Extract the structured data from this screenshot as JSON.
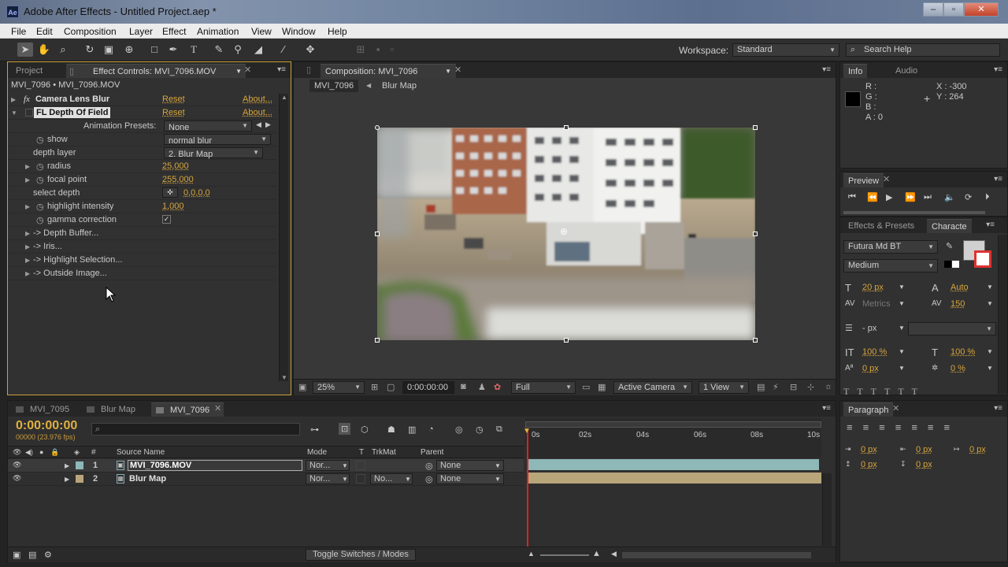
{
  "app": {
    "title": "Adobe After Effects - Untitled Project.aep *",
    "icon": "Ae",
    "window_controls": [
      "–",
      "▫",
      "✕"
    ]
  },
  "menu": [
    "File",
    "Edit",
    "Composition",
    "Layer",
    "Effect",
    "Animation",
    "View",
    "Window",
    "Help"
  ],
  "toolbar": {
    "workspace_label": "Workspace:",
    "workspace_value": "Standard",
    "search_placeholder": "Search Help"
  },
  "left_panel": {
    "tabs": [
      "Project",
      "Effect Controls: MVI_7096.MOV"
    ],
    "breadcrumb": "MVI_7096 • MVI_7096.MOV",
    "effects": [
      {
        "name": "Camera Lens Blur",
        "reset": "Reset",
        "about": "About...",
        "fx": "fx"
      },
      {
        "name": "FL Depth Of Field",
        "reset": "Reset",
        "about": "About..."
      }
    ],
    "animation_presets_label": "Animation Presets:",
    "animation_presets_value": "None",
    "params": {
      "show_label": "show",
      "show_value": "normal blur",
      "depth_layer_label": "depth layer",
      "depth_layer_value": "2. Blur Map",
      "radius_label": "radius",
      "radius_value": "25,000",
      "focal_label": "focal point",
      "focal_value": "255,000",
      "select_depth_label": "select depth",
      "select_depth_value": "0,0,0,0",
      "highlight_label": "highlight intensity",
      "highlight_value": "1,000",
      "gamma_label": "gamma correction",
      "gamma_check": "✓"
    },
    "groups": [
      "-> Depth Buffer...",
      "-> Iris...",
      "-> Highlight Selection...",
      "-> Outside Image..."
    ]
  },
  "comp_panel": {
    "tab": "Composition: MVI_7096",
    "crumbs": [
      "MVI_7096",
      "Blur Map"
    ],
    "zoom": "25%",
    "timecode": "0:00:00:00",
    "resolution": "Full",
    "camera": "Active Camera",
    "view": "1 View"
  },
  "info_panel": {
    "tabs": [
      "Info",
      "Audio"
    ],
    "r": "R :",
    "g": "G :",
    "b": "B :",
    "a": "A : 0",
    "x": "X : -300",
    "y": "Y : 264"
  },
  "preview_panel": {
    "tab": "Preview"
  },
  "character_panel": {
    "tabs": [
      "Effects & Presets",
      "Characte"
    ],
    "font": "Futura Md BT",
    "style": "Medium",
    "size": "20 px",
    "leading": "Auto",
    "kerning": "Metrics",
    "tracking": "150",
    "stroke": "- px",
    "vscale": "100 %",
    "hscale": "100 %",
    "baseline": "0 px",
    "tsume": "0 %"
  },
  "paragraph_panel": {
    "tab": "Paragraph",
    "indent1": "0 px",
    "indent2": "0 px",
    "indent3": "0 px",
    "space1": "0 px",
    "space2": "0 px"
  },
  "timeline": {
    "tabs": [
      "MVI_7095",
      "Blur Map",
      "MVI_7096"
    ],
    "timecode": "0:00:00:00",
    "fps": "00000 (23.976 fps)",
    "col_num": "#",
    "col_source": "Source Name",
    "col_mode": "Mode",
    "col_t": "T",
    "col_trkmat": "TrkMat",
    "col_parent": "Parent",
    "ruler": [
      "0s",
      "02s",
      "04s",
      "06s",
      "08s",
      "10s"
    ],
    "layers": [
      {
        "num": "1",
        "name": "MVI_7096.MOV",
        "mode": "Nor...",
        "trkmat": "",
        "parent": "None",
        "color": "#8fb8b8"
      },
      {
        "num": "2",
        "name": "Blur Map",
        "mode": "Nor...",
        "trkmat": "No...",
        "parent": "None",
        "color": "#b8a57a"
      }
    ],
    "toggle_label": "Toggle Switches / Modes"
  }
}
